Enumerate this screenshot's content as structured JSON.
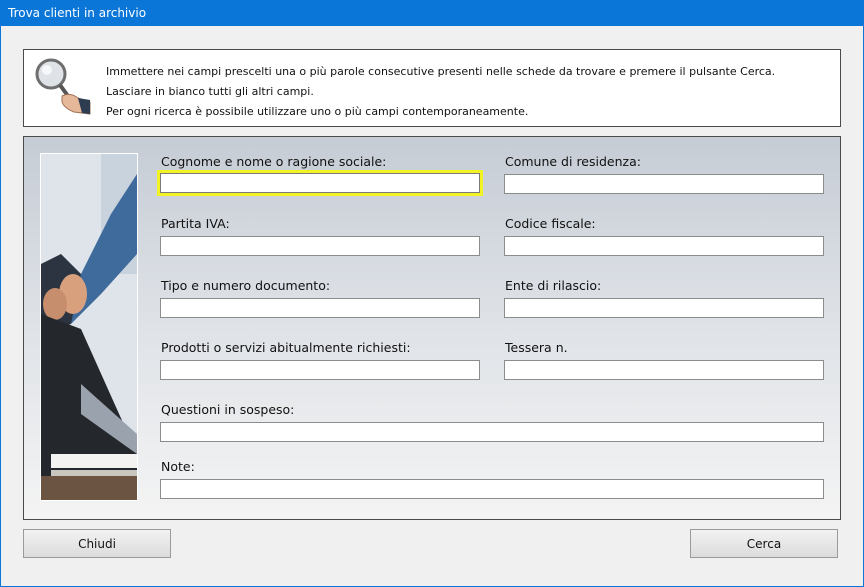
{
  "window": {
    "title": "Trova clienti in archivio"
  },
  "info": {
    "icon": "magnifier-hand-icon",
    "lines": [
      "Immettere nei campi prescelti una o più parole consecutive presenti nelle schede da trovare e premere il pulsante Cerca.",
      "Lasciare in bianco tutti gli altri campi.",
      "Per ogni ricerca è possibile utilizzare uno o più campi contemporaneamente."
    ]
  },
  "form": {
    "photo": "business-handshake-photo",
    "fields": {
      "nome": {
        "label": "Cognome e nome o ragione sociale:",
        "value": ""
      },
      "comune": {
        "label": "Comune di residenza:",
        "value": ""
      },
      "piva": {
        "label": "Partita IVA:",
        "value": ""
      },
      "cf": {
        "label": "Codice fiscale:",
        "value": ""
      },
      "documento": {
        "label": "Tipo e numero documento:",
        "value": ""
      },
      "ente": {
        "label": "Ente di rilascio:",
        "value": ""
      },
      "prodotti": {
        "label": "Prodotti o servizi abitualmente richiesti:",
        "value": ""
      },
      "tessera": {
        "label": "Tessera n.",
        "value": ""
      },
      "questioni": {
        "label": "Questioni in sospeso:",
        "value": ""
      },
      "note": {
        "label": "Note:",
        "value": ""
      }
    }
  },
  "buttons": {
    "close": "Chiudi",
    "search": "Cerca"
  },
  "colors": {
    "titlebar": "#0a77d8",
    "focus_border": "#f2f224"
  }
}
